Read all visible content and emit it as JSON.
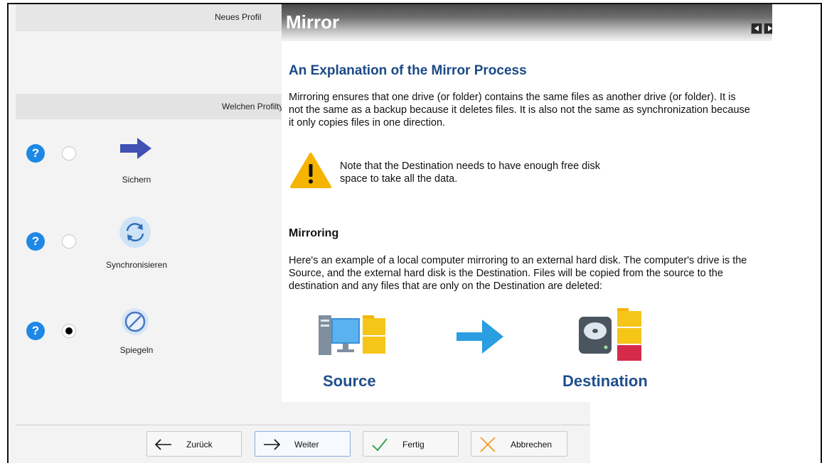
{
  "wizard": {
    "header_title": "Neues Profil",
    "question": "Welchen Profiltyp",
    "options": [
      {
        "label": "Sichern",
        "selected": false,
        "icon": "arrow-right-icon"
      },
      {
        "label": "Synchronisieren",
        "selected": false,
        "icon": "sync-icon"
      },
      {
        "label": "Spiegeln",
        "selected": true,
        "icon": "mirror-icon"
      }
    ],
    "buttons": {
      "back": "Zurück",
      "next": "Weiter",
      "finish": "Fertig",
      "cancel": "Abbrechen"
    }
  },
  "help": {
    "window_title": "Mirror",
    "heading": "An Explanation of the Mirror Process",
    "intro": "Mirroring ensures that one drive (or folder) contains the same files as another drive (or folder). It is not the same as a backup because it deletes files. It is also not the same as synchronization because it only copies files in one direction.",
    "note": "Note that the Destination needs to have enough free disk space to take all the data.",
    "section_title": "Mirroring",
    "section_text": "Here's an example of a local computer mirroring to an external hard disk. The computer's drive is the Source, and the external hard disk is the Destination. Files will be copied from the source to the destination and any files that are only on the Destination are deleted:",
    "source_label": "Source",
    "destination_label": "Destination"
  },
  "colors": {
    "help_heading": "#1a4a86",
    "help_icon": "#1e88e5",
    "big_label": "#1f4f8c",
    "warning": "#f5b400"
  }
}
